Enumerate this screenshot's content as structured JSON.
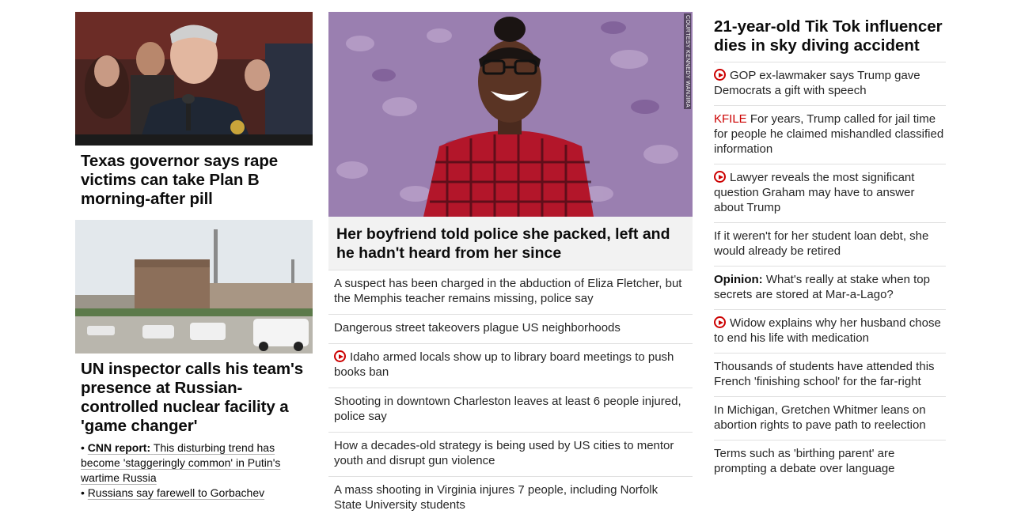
{
  "left": {
    "card1": {
      "image_alt": "Texas governor at press conference",
      "headline": "Texas governor says rape victims can take Plan B morning-after pill"
    },
    "card2": {
      "image_alt": "Nuclear power plant with UN vehicles",
      "headline": "UN inspector calls his team's presence at Russian-controlled nuclear facility a 'game changer'",
      "sub_items": [
        {
          "bullet": "•",
          "prefix": "CNN report:",
          "text": "This disturbing trend has become 'staggeringly common' in Putin's wartime Russia"
        },
        {
          "bullet": "•",
          "prefix": "",
          "text": "Russians say farewell to Gorbachev"
        }
      ]
    }
  },
  "middle": {
    "hero": {
      "image_alt": "Woman smiling among autumn leaves",
      "credit": "COURTESY KENNEDY WANJIRA",
      "headline": "Her boyfriend told police she packed, left and he hadn't heard from her since"
    },
    "items": [
      {
        "video": false,
        "text": "A suspect has been charged in the abduction of Eliza Fletcher, but the Memphis teacher remains missing, police say"
      },
      {
        "video": false,
        "text": "Dangerous street takeovers plague US neighborhoods"
      },
      {
        "video": true,
        "text": "Idaho armed locals show up to library board meetings to push books ban"
      },
      {
        "video": false,
        "text": "Shooting in downtown Charleston leaves at least 6 people injured, police say"
      },
      {
        "video": false,
        "text": "How a decades-old strategy is being used by US cities to mentor youth and disrupt gun violence"
      },
      {
        "video": false,
        "text": "A mass shooting in Virginia injures 7 people, including Norfolk State University students"
      }
    ]
  },
  "right": {
    "headline": "21-year-old Tik Tok influencer dies in sky diving accident",
    "items": [
      {
        "label": "",
        "video": true,
        "text": "GOP ex-lawmaker says Trump gave Democrats a gift with speech"
      },
      {
        "label": "KFILE",
        "video": false,
        "text": "For years, Trump called for jail time for people he claimed mishandled classified information"
      },
      {
        "label": "",
        "video": true,
        "text": "Lawyer reveals the most significant question Graham may have to answer about Trump"
      },
      {
        "label": "",
        "video": false,
        "text": "If it weren't for her student loan debt, she would already be retired"
      },
      {
        "label": "Opinion:",
        "video": false,
        "text": "What's really at stake when top secrets are stored at Mar-a-Lago?"
      },
      {
        "label": "",
        "video": true,
        "text": "Widow explains why her husband chose to end his life with medication"
      },
      {
        "label": "",
        "video": false,
        "text": "Thousands of students have attended this French 'finishing school' for the far-right"
      },
      {
        "label": "",
        "video": false,
        "text": "In Michigan, Gretchen Whitmer leans on abortion rights to pave path to reelection"
      },
      {
        "label": "",
        "video": false,
        "text": "Terms such as 'birthing parent' are prompting a debate over language"
      }
    ]
  },
  "icons": {
    "video": "play-circle-icon"
  },
  "colors": {
    "accent": "#cc0000",
    "divider": "#e0e0e0",
    "headline_bg": "#f2f2f2"
  }
}
